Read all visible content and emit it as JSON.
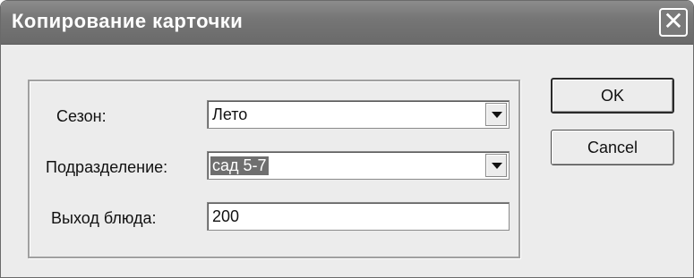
{
  "window": {
    "title": "Копирование карточки",
    "close_label": "✕"
  },
  "form": {
    "season": {
      "label": "Сезон:",
      "value": "Лето"
    },
    "division": {
      "label": "Подразделение:",
      "value": "сад 5-7"
    },
    "dish_yield": {
      "label": "Выход блюда:",
      "value": "200"
    }
  },
  "buttons": {
    "ok_label": "OK",
    "cancel_label": "Cancel"
  }
}
